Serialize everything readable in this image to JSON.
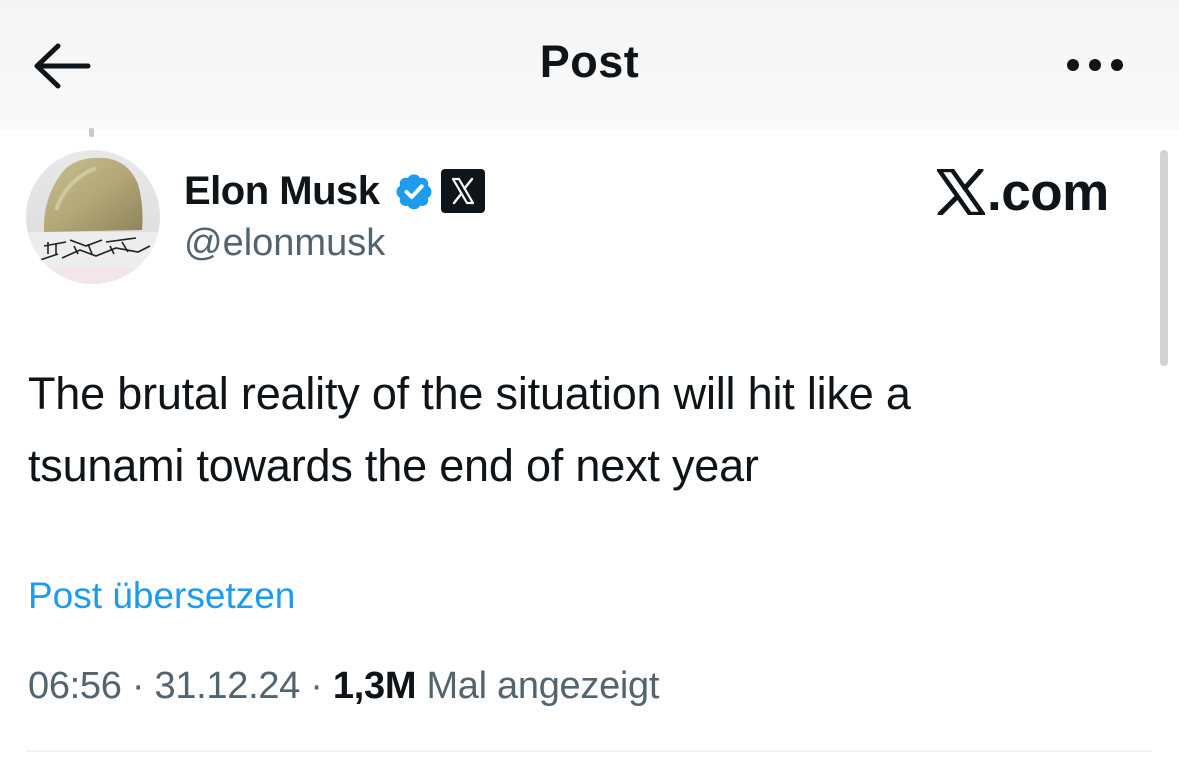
{
  "header": {
    "title": "Post",
    "back_icon": "arrow-left-icon",
    "more_icon": "more-horizontal-icon"
  },
  "post": {
    "author": {
      "name": "Elon Musk",
      "handle": "@elonmusk",
      "verified_icon": "verified-badge-icon",
      "affiliation_icon": "x-logo-badge-icon",
      "affiliation_text": ".com",
      "avatar_text": "THE FUTURE IS AUTONOMOUS"
    },
    "text_line1": "The brutal reality of the situation will hit like a",
    "text_line2": "tsunami towards the end of next year",
    "translate_label": "Post übersetzen",
    "time": "06:56",
    "date": "31.12.24",
    "separator": "·",
    "views_count": "1,3M",
    "views_label": "Mal angezeigt"
  },
  "colors": {
    "link": "#1d9bf0",
    "verified": "#1d9bf0",
    "secondary_text": "#536471",
    "primary_text": "#0f1419"
  }
}
